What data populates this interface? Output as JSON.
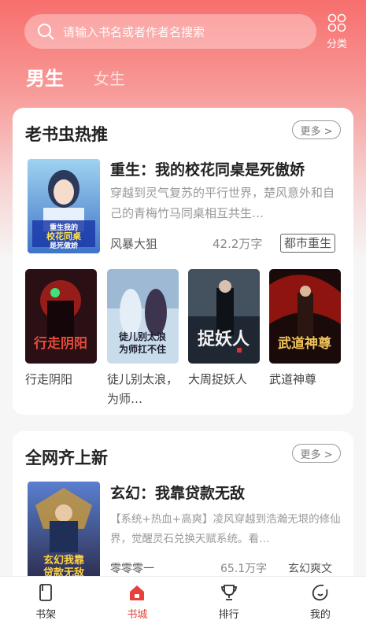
{
  "colors": {
    "accent": "#e8413c",
    "header_top": "#f76f6d"
  },
  "search": {
    "placeholder": "请输入书名或者作者名搜索"
  },
  "header": {
    "category_label": "分类",
    "tab_male": "男生",
    "tab_female": "女生"
  },
  "section1": {
    "title": "老书虫热推",
    "more": "更多 >",
    "featured": {
      "title": "重生：我的校花同桌是死傲娇",
      "desc": "穿越到灵气复苏的平行世界，楚风意外和自己的青梅竹马同桌相互共生…",
      "author": "风暴大狙",
      "words": "42.2万字",
      "tag": "都市重生",
      "cover_text": "重生我的校花同桌是死傲娇"
    },
    "books": [
      {
        "name": "行走阴阳",
        "cover_text": "行走阴阳"
      },
      {
        "name": "徒儿别太浪，为师…",
        "cover_text": "徒儿别太浪为师扛不住"
      },
      {
        "name": "大周捉妖人",
        "cover_text": "捉妖人"
      },
      {
        "name": "武道神尊",
        "cover_text": "武道神尊"
      }
    ]
  },
  "section2": {
    "title": "全网齐上新",
    "more": "更多 >",
    "featured": {
      "title": "玄幻：我靠贷款无敌",
      "desc": "【系统+热血+高爽】凌风穿越到浩瀚无垠的修仙界，觉醒灵石兑换天赋系统。看…",
      "author": "零零零一",
      "words": "65.1万字",
      "tag": "玄幻爽文",
      "cover_text": "玄幻我靠贷款无敌"
    }
  },
  "nav": [
    {
      "label": "书架",
      "icon": "bookshelf-icon"
    },
    {
      "label": "书城",
      "icon": "bookstore-icon"
    },
    {
      "label": "排行",
      "icon": "trophy-icon"
    },
    {
      "label": "我的",
      "icon": "profile-icon"
    }
  ]
}
